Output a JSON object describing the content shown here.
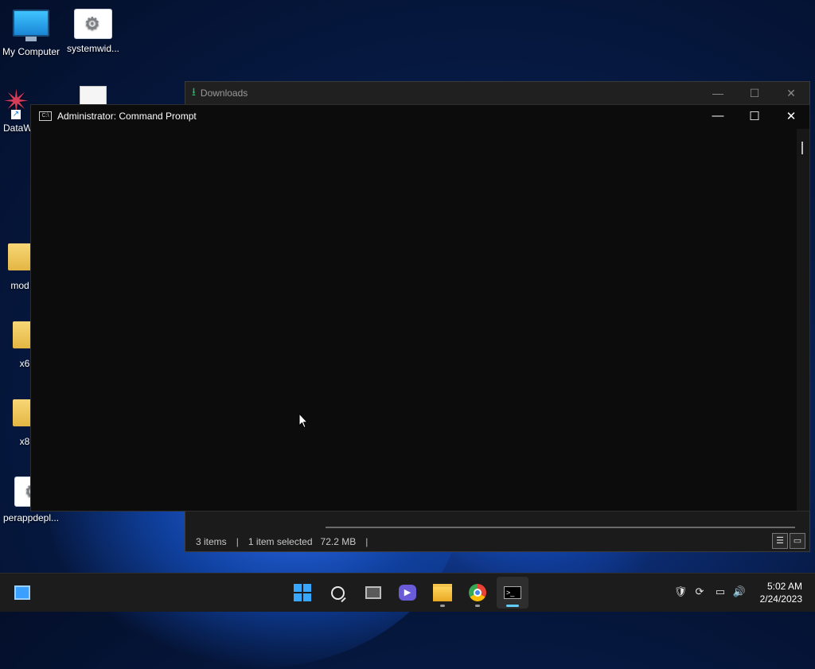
{
  "desktop": {
    "icons": [
      {
        "label": "My Computer"
      },
      {
        "label": "systemwid..."
      },
      {
        "label": "DataW"
      },
      {
        "label": "mod"
      },
      {
        "label": "x6"
      },
      {
        "label": "x8"
      },
      {
        "label": "perappdepl..."
      }
    ]
  },
  "downloads_window": {
    "title": "Downloads",
    "status": {
      "items": "3 items",
      "selected": "1 item selected",
      "size": "72.2 MB"
    }
  },
  "cmd_window": {
    "title": "Administrator:  Command Prompt",
    "icon_text": "C:\\"
  },
  "taskbar": {
    "apps": [
      "widgets",
      "start",
      "search",
      "task-view",
      "chat",
      "file-explorer",
      "chrome",
      "command-prompt"
    ],
    "active_app": "command-prompt",
    "clock": {
      "time": "5:02 AM",
      "date": "2/24/2023"
    }
  }
}
